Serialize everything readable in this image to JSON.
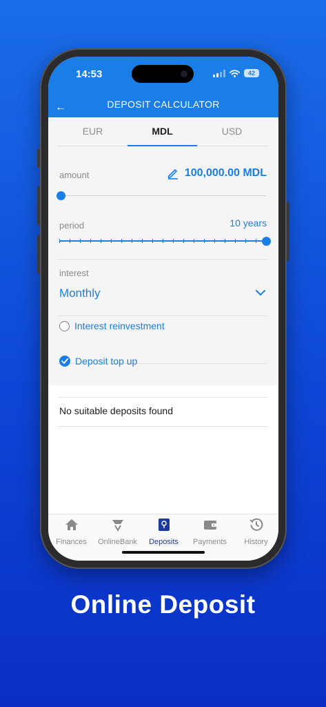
{
  "status_bar": {
    "time": "14:53",
    "battery": "42"
  },
  "nav": {
    "back_glyph": "←",
    "title": "DEPOSIT CALCULATOR"
  },
  "currency_tabs": [
    {
      "label": "EUR",
      "active": false
    },
    {
      "label": "MDL",
      "active": true
    },
    {
      "label": "USD",
      "active": false
    }
  ],
  "amount": {
    "label": "amount",
    "value": "100,000.00 MDL",
    "icon": "pencil-icon",
    "slider_fraction": 0.0
  },
  "period": {
    "label": "period",
    "value": "10 years",
    "slider_fraction": 1.0,
    "steps": 10
  },
  "interest": {
    "label": "interest",
    "value": "Monthly",
    "icon": "chevron-down-icon"
  },
  "options": [
    {
      "label": "Interest reinvestment",
      "checked": false
    },
    {
      "label": "Deposit top up",
      "checked": true
    }
  ],
  "result": {
    "message": "No suitable deposits found"
  },
  "tab_bar": [
    {
      "label": "Finances",
      "icon": "home-icon",
      "active": false
    },
    {
      "label": "OnlineBank",
      "icon": "onlinebank-icon",
      "active": false
    },
    {
      "label": "Deposits",
      "icon": "deposit-safe-icon",
      "active": true
    },
    {
      "label": "Payments",
      "icon": "wallet-icon",
      "active": false
    },
    {
      "label": "History",
      "icon": "history-icon",
      "active": false
    }
  ],
  "headline": "Online Deposit",
  "colors": {
    "accent": "#1a7ee6",
    "active_tab": "#1c3a9e",
    "background": "#0d46d6"
  }
}
